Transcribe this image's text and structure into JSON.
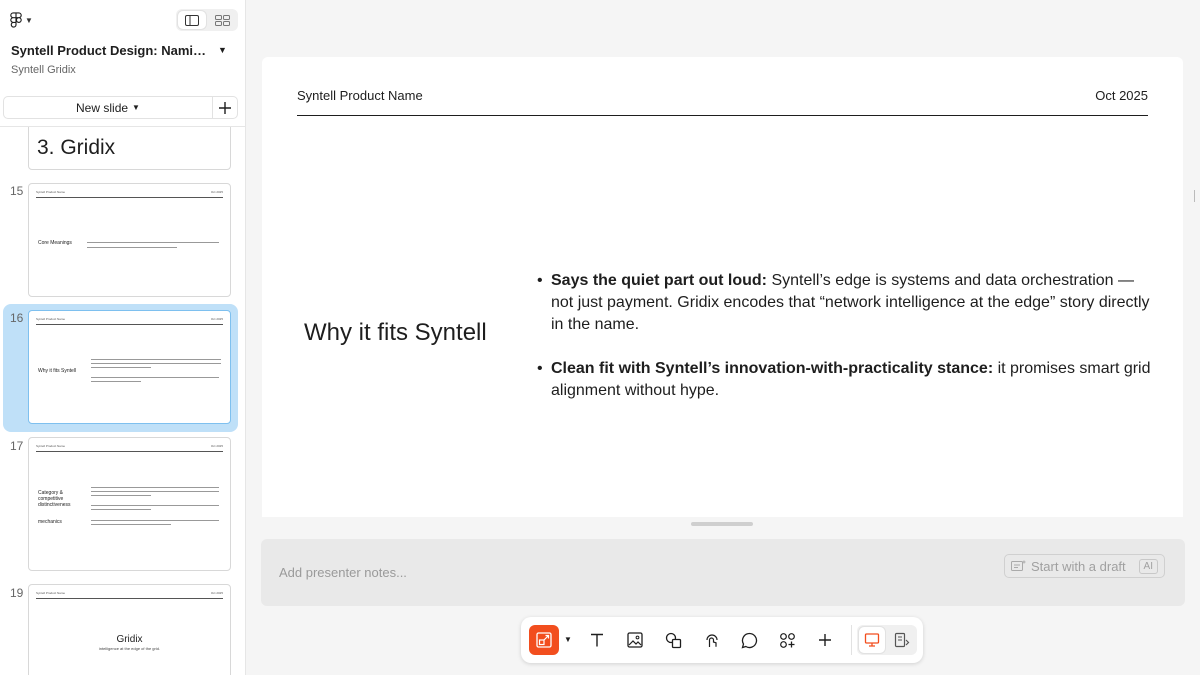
{
  "app": {
    "file_title": "Syntell Product Design: Namin...",
    "file_subtitle": "Syntell Gridix"
  },
  "sidebar": {
    "new_slide_label": "New slide",
    "add_label": "+",
    "thumbnails": [
      {
        "number": "",
        "title": "3. Gridix"
      },
      {
        "number": "15",
        "title": "Core Meanings",
        "head_left": "Syntell Product Name",
        "head_right": "Oct 2025"
      },
      {
        "number": "16",
        "title": "Why it fits Syntell",
        "head_left": "Syntell Product Name",
        "head_right": "Oct 2025"
      },
      {
        "number": "17",
        "title": "Category & competitive distinctiveness",
        "title2": "mechanics",
        "head_left": "Syntell Product Name",
        "head_right": "Oct 2025"
      },
      {
        "number": "19",
        "title": "Gridix",
        "subtitle": "intelligence at the edge of the grid.",
        "head_left": "Syntell Product Name",
        "head_right": "Oct 2025"
      }
    ]
  },
  "slide": {
    "header_left": "Syntell Product Name",
    "header_right": "Oct 2025",
    "title": "Why it fits Syntell",
    "bullets": [
      {
        "bold": "Says the quiet part out loud:",
        "text": " Syntell’s edge is systems and data orchestration — not just payment. Gridix encodes that “network intelligence at the edge” story directly in the name."
      },
      {
        "bold": "Clean fit with Syntell’s innovation-with-practicality stance:",
        "text": " it promises smart grid alignment without hype."
      }
    ]
  },
  "notes": {
    "placeholder": "Add presenter notes...",
    "draft_label": "Start with a draft",
    "ai_badge": "AI"
  },
  "colors": {
    "accent": "#f24e1e",
    "selection": "#bfe0f8"
  }
}
